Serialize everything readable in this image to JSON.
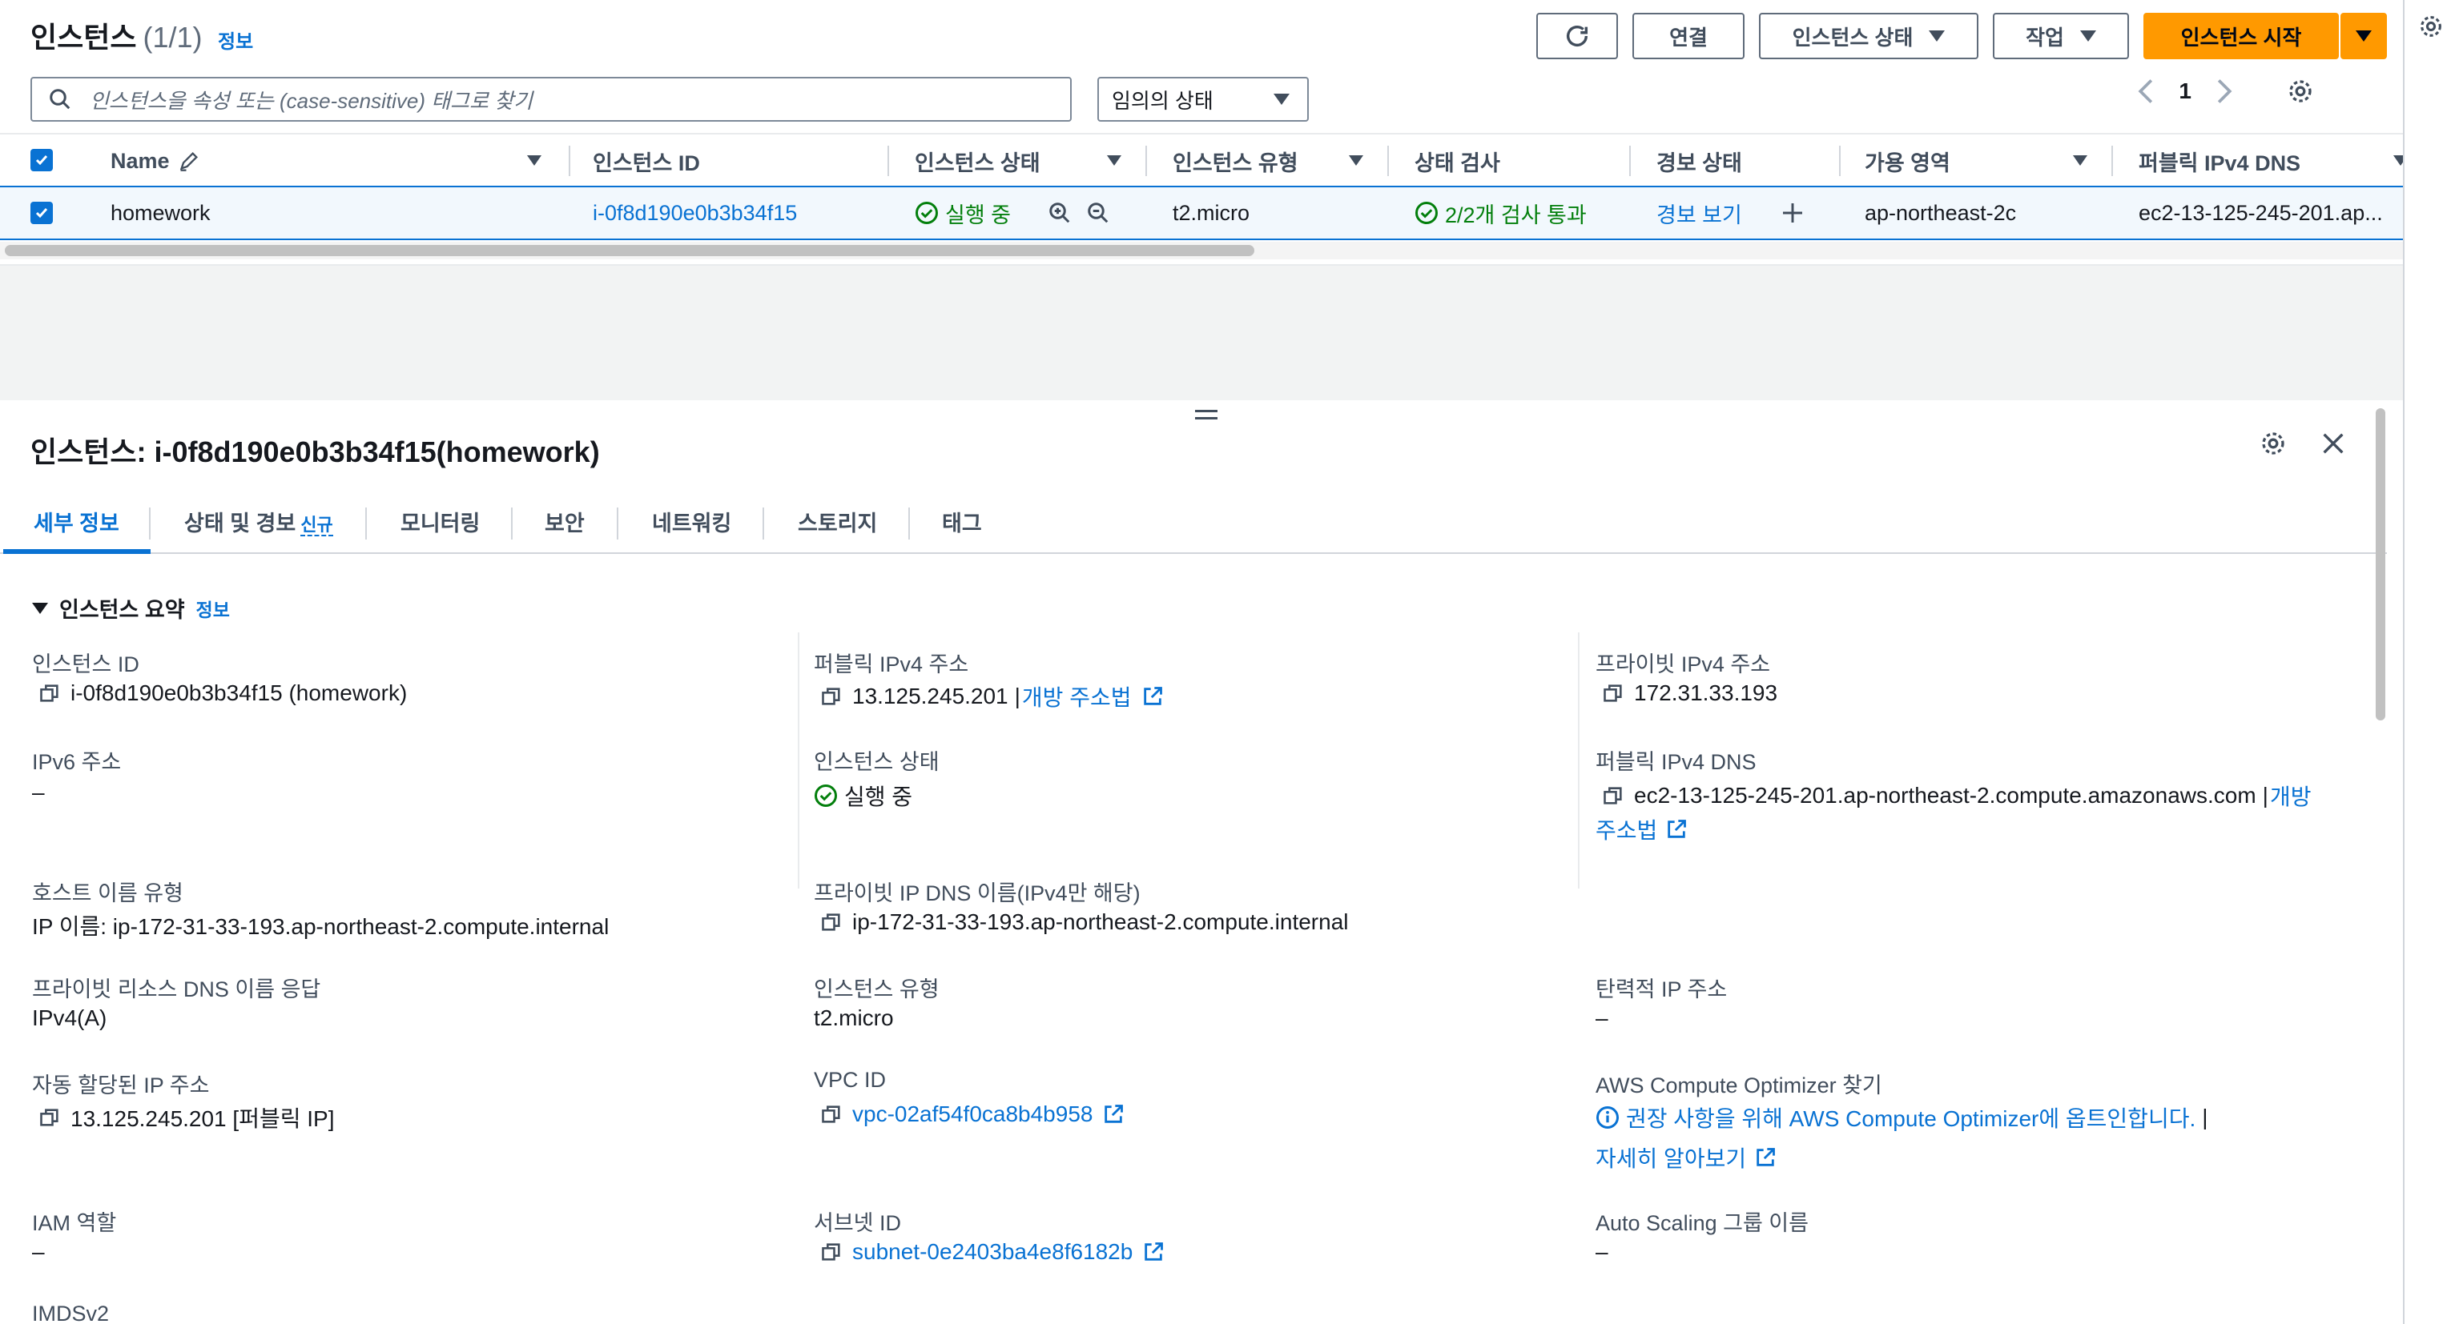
{
  "header": {
    "title": "인스턴스",
    "count": "(1/1)",
    "info": "정보",
    "connect": "연결",
    "instance_state": "인스턴스 상태",
    "actions": "작업",
    "launch": "인스턴스 시작",
    "search_placeholder": "인스턴스을 속성 또는 (case-sensitive) 태그로 찾기",
    "state_filter": "임의의 상태",
    "page": "1"
  },
  "table": {
    "columns": [
      "Name",
      "인스턴스 ID",
      "인스턴스 상태",
      "인스턴스 유형",
      "상태 검사",
      "경보 상태",
      "가용 영역",
      "퍼블릭 IPv4 DNS"
    ],
    "row": {
      "name": "homework",
      "id": "i-0f8d190e0b3b34f15",
      "state": "실행 중",
      "type": "t2.micro",
      "check": "2/2개 검사 통과",
      "alarm": "경보 보기",
      "az": "ap-northeast-2c",
      "dns": "ec2-13-125-245-201.ap..."
    }
  },
  "detail": {
    "title": "인스턴스: i-0f8d190e0b3b34f15(homework)",
    "tabs": [
      "세부 정보",
      "상태 및 경보",
      "모니터링",
      "보안",
      "네트워킹",
      "스토리지",
      "태그"
    ],
    "new_badge": "신규",
    "section": "인스턴스 요약",
    "section_info": "정보",
    "fields": {
      "instance_id_label": "인스턴스 ID",
      "instance_id_value": "i-0f8d190e0b3b34f15 (homework)",
      "ipv6_label": "IPv6 주소",
      "ipv6_value": "–",
      "hostname_type_label": "호스트 이름 유형",
      "hostname_type_value": "IP 이름: ip-172-31-33-193.ap-northeast-2.compute.internal",
      "private_dns_resp_label": "프라이빗 리소스 DNS 이름 응답",
      "private_dns_resp_value": "IPv4(A)",
      "auto_ip_label": "자동 할당된 IP 주소",
      "auto_ip_value": "13.125.245.201 [퍼블릭 IP]",
      "iam_label": "IAM 역할",
      "iam_value": "–",
      "imds_label": "IMDSv2",
      "public_ip_label": "퍼블릭 IPv4 주소",
      "public_ip_value": "13.125.245.201",
      "open_addr": "개방 주소법",
      "state_label": "인스턴스 상태",
      "state_value": "실행 중",
      "private_dns_label": "프라이빗 IP DNS 이름(IPv4만 해당)",
      "private_dns_value": "ip-172-31-33-193.ap-northeast-2.compute.internal",
      "type_label": "인스턴스 유형",
      "type_value": "t2.micro",
      "vpc_label": "VPC ID",
      "vpc_value": "vpc-02af54f0ca8b4b958",
      "subnet_label": "서브넷 ID",
      "subnet_value": "subnet-0e2403ba4e8f6182b",
      "private_ip_label": "프라이빗 IPv4 주소",
      "private_ip_value": "172.31.33.193",
      "public_dns_label": "퍼블릭 IPv4 DNS",
      "public_dns_value": "ec2-13-125-245-201.ap-northeast-2.compute.amazonaws.com",
      "open_addr_1": "개방",
      "open_addr_2": "주소법",
      "elastic_label": "탄력적 IP 주소",
      "elastic_value": "–",
      "optimizer_label": "AWS Compute Optimizer 찾기",
      "optimizer_value": "권장 사항을 위해 AWS Compute Optimizer에 옵트인합니다.",
      "learn_more": "자세히 알아보기",
      "asg_label": "Auto Scaling 그룹 이름",
      "asg_value": "–"
    }
  },
  "colors": {
    "link": "#0972d3",
    "success": "#037f0c",
    "primary": "#ff9900"
  }
}
